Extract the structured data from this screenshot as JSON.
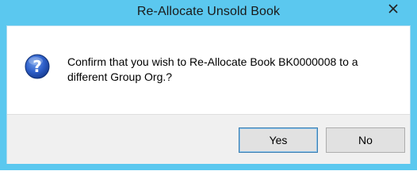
{
  "window": {
    "title": "Re-Allocate Unsold Book",
    "frame_color": "#5bc8ef"
  },
  "dialog": {
    "icon": "question-icon",
    "message": "Confirm that you wish to Re-Allocate Book BK0000008 to a different Group Org.?"
  },
  "buttons": {
    "yes_label": "Yes",
    "no_label": "No"
  }
}
